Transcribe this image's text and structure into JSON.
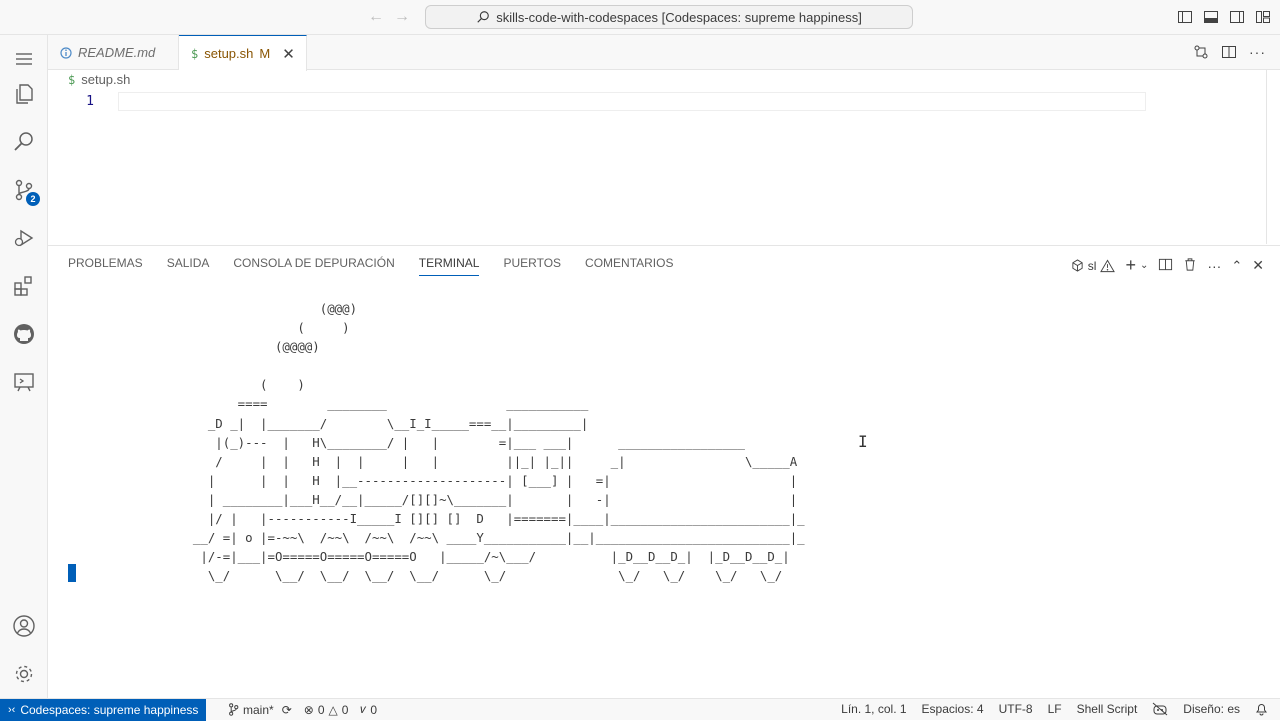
{
  "titlebar": {
    "command_center": "skills-code-with-codespaces [Codespaces: supreme happiness]"
  },
  "activity": {
    "scm_badge": "2"
  },
  "tabs": [
    {
      "label": "README.md",
      "icon": "info-icon",
      "active": false
    },
    {
      "label": "setup.sh",
      "modified": "M",
      "icon": "dollar-icon",
      "active": true
    }
  ],
  "editor": {
    "breadcrumb": "setup.sh",
    "line_number": "1"
  },
  "panel": {
    "tabs": [
      "PROBLEMAS",
      "SALIDA",
      "CONSOLA DE DEPURACIÓN",
      "TERMINAL",
      "PUERTOS",
      "COMENTARIOS"
    ],
    "active_tab": "TERMINAL",
    "terminal_name": "sl",
    "terminal_output": "                   (@@@)\n                (     )\n             (@@@@)\n\n           (    )\n        ====        ________                ___________\n    _D _|  |_______/        \\__I_I_____===__|_________|\n     |(_)---  |   H\\________/ |   |        =|___ ___|      _________________\n     /     |  |   H  |  |     |   |         ||_| |_||     _|                \\_____A\n    |      |  |   H  |__--------------------| [___] |   =|                        |\n    | ________|___H__/__|_____/[][]~\\_______|       |   -|                        |\n    |/ |   |-----------I_____I [][] []  D   |=======|____|________________________|_\n  __/ =| o |=-~~\\  /~~\\  /~~\\  /~~\\ ____Y___________|__|__________________________|_\n   |/-=|___|=O=====O=====O=====O   |_____/~\\___/          |_D__D__D_|  |_D__D__D_|\n    \\_/      \\__/  \\__/  \\__/  \\__/      \\_/               \\_/   \\_/    \\_/   \\_/"
  },
  "statusbar": {
    "remote": "Codespaces: supreme happiness",
    "branch": "main*",
    "errors": "0",
    "warnings": "0",
    "ports": "0",
    "position": "Lín. 1, col. 1",
    "spaces": "Espacios: 4",
    "encoding": "UTF-8",
    "eol": "LF",
    "language": "Shell Script",
    "layout": "Diseño: es"
  }
}
